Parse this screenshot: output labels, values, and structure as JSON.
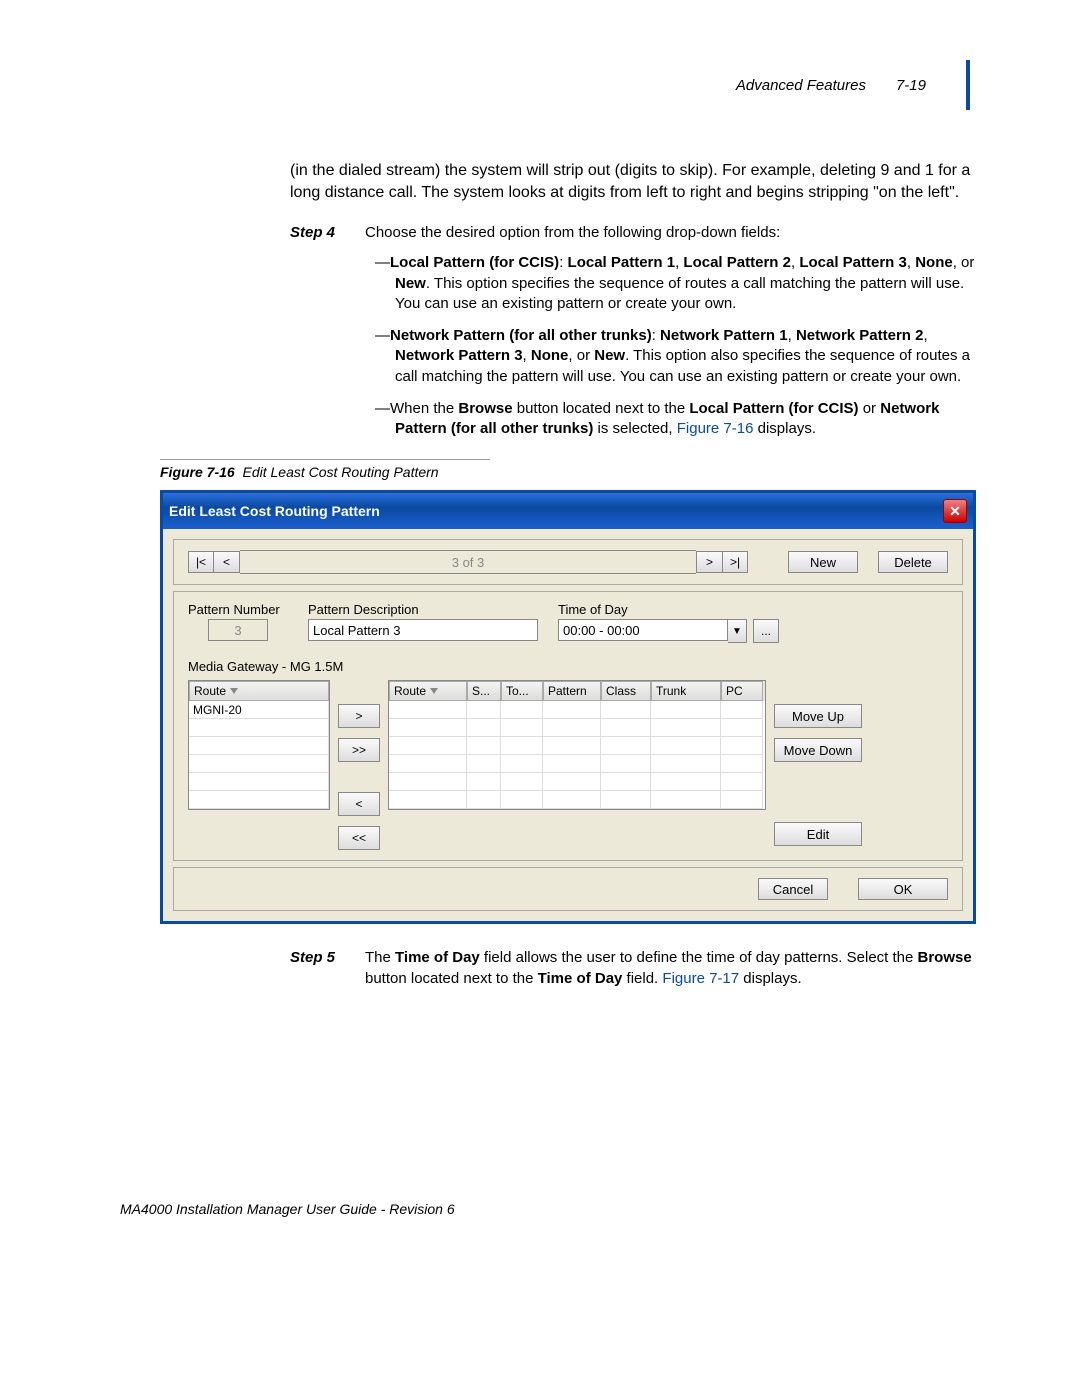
{
  "header": {
    "section": "Advanced Features",
    "page": "7-19"
  },
  "intro_para": "(in the dialed stream) the system will strip out (digits to skip). For example, deleting 9 and 1 for a long distance call. The system looks at digits from left to right and begins stripping \"on the left\".",
  "step4": {
    "label": "Step 4",
    "text": "Choose the desired option from the following drop-down fields:"
  },
  "bullets": {
    "b1_strong": "Local Pattern (for CCIS)",
    "b1_colon": ": ",
    "b1_opts": "Local Pattern 1",
    "b1_c1": ", ",
    "b1_opt2": "Local Pattern 2",
    "b1_c2": ", ",
    "b1_opt3": "Local Pattern 3",
    "b1_c3": ", ",
    "b1_opt4": "None",
    "b1_or": ", or ",
    "b1_opt5": "New",
    "b1_tail": ". This option specifies the sequence of routes a call matching the pattern will use. You can use an existing pattern or create your own.",
    "b2_strong": "Network Pattern (for all other trunks)",
    "b2_colon": ": ",
    "b2_opts": "Network Pattern 1",
    "b2_c1": ", ",
    "b2_opt2": "Network Pattern 2",
    "b2_c2": ", ",
    "b2_opt3": "Network Pattern 3",
    "b2_c3": ", ",
    "b2_opt4": "None",
    "b2_or": ", or ",
    "b2_opt5": "New",
    "b2_tail": ". This option also specifies the sequence of routes a call matching the pattern will use. You can use an existing pattern or create your own.",
    "b3_pre": "When the ",
    "b3_browse": "Browse",
    "b3_mid": " button located next to the ",
    "b3_lp": "Local Pattern (for CCIS)",
    "b3_or": " or ",
    "b3_np": "Network Pattern (for all other trunks)",
    "b3_sel": " is selected, ",
    "b3_fig": "Figure 7-16",
    "b3_tail": " displays."
  },
  "figure": {
    "label": "Figure 7-16",
    "caption": "Edit Least Cost Routing Pattern"
  },
  "dialog": {
    "title": "Edit Least Cost Routing Pattern",
    "nav_first": "|<",
    "nav_prev": "<",
    "counter": "3 of 3",
    "nav_next": ">",
    "nav_last": ">|",
    "btn_new": "New",
    "btn_delete": "Delete",
    "labels": {
      "pattern_number": "Pattern Number",
      "pattern_desc": "Pattern Description",
      "tod": "Time of Day",
      "mg": "Media Gateway - MG 1.5M"
    },
    "values": {
      "pattern_number": "3",
      "pattern_desc": "Local Pattern 3",
      "tod": "00:00 - 00:00"
    },
    "browse_dots": "...",
    "left_grid": {
      "headers": [
        "Route"
      ],
      "rows": [
        "MGNI-20",
        "",
        "",
        "",
        "",
        ""
      ]
    },
    "movers": [
      ">",
      ">>",
      "<",
      "<<"
    ],
    "right_grid": {
      "headers": [
        "Route",
        "S...",
        "To...",
        "Pattern",
        "Class",
        "Trunk",
        "PC"
      ],
      "widths": [
        78,
        34,
        42,
        58,
        50,
        70,
        42
      ],
      "rows": [
        [
          "",
          "",
          "",
          "",
          "",
          "",
          ""
        ],
        [
          "",
          "",
          "",
          "",
          "",
          "",
          ""
        ],
        [
          "",
          "",
          "",
          "",
          "",
          "",
          ""
        ],
        [
          "",
          "",
          "",
          "",
          "",
          "",
          ""
        ],
        [
          "",
          "",
          "",
          "",
          "",
          "",
          ""
        ],
        [
          "",
          "",
          "",
          "",
          "",
          "",
          ""
        ]
      ]
    },
    "side_btns": {
      "move_up": "Move Up",
      "move_down": "Move Down",
      "edit": "Edit"
    },
    "footer": {
      "cancel": "Cancel",
      "ok": "OK"
    }
  },
  "step5": {
    "label": "Step 5",
    "pre": "The ",
    "tod": "Time of Day",
    "mid": " field allows the user to define the time of day patterns. Select the ",
    "browse": "Browse",
    "mid2": " button located next to the ",
    "tod2": "Time of Day",
    "mid3": " field. ",
    "fig": "Figure 7-17",
    "tail": " displays."
  },
  "footer": "MA4000 Installation Manager User Guide - Revision 6"
}
